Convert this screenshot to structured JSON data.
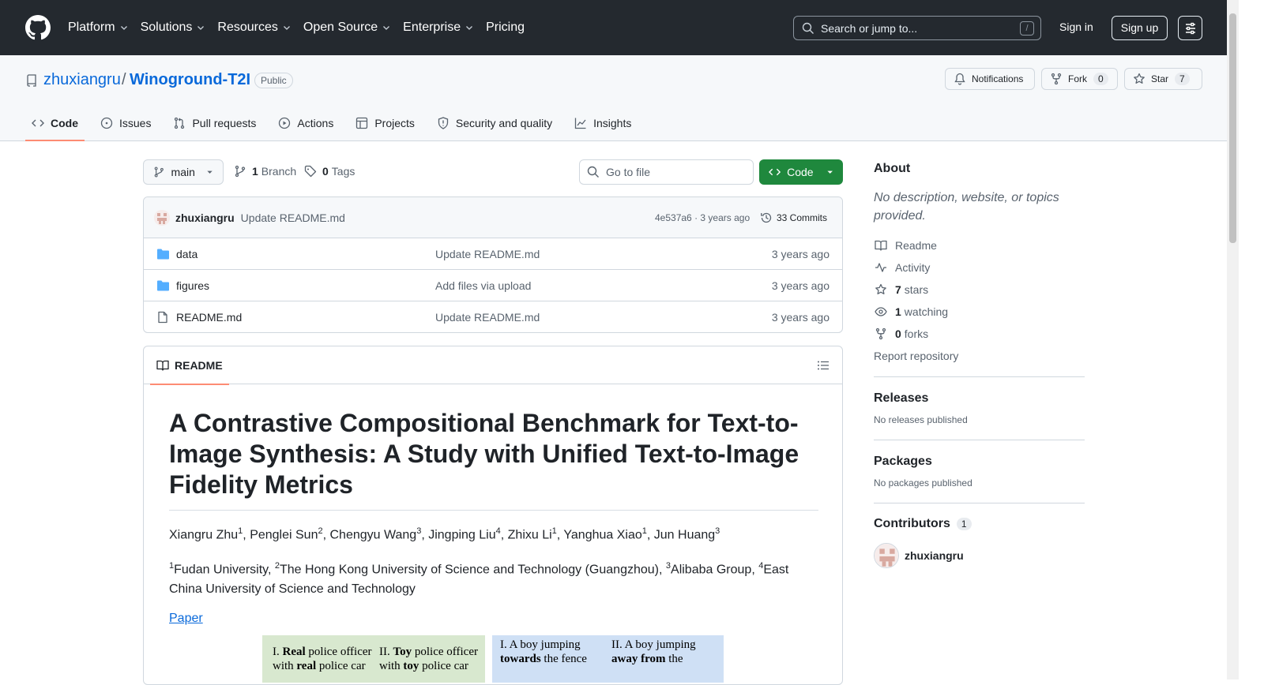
{
  "global_nav": {
    "items": [
      "Platform",
      "Solutions",
      "Resources",
      "Open Source",
      "Enterprise",
      "Pricing"
    ],
    "search_placeholder": "Search or jump to...",
    "search_shortcut": "/",
    "sign_in": "Sign in",
    "sign_up": "Sign up"
  },
  "repo": {
    "owner": "zhuxiangru",
    "separator": "/",
    "name": "Winoground-T2I",
    "visibility": "Public",
    "notifications_label": "Notifications",
    "fork_label": "Fork",
    "fork_count": "0",
    "star_label": "Star",
    "star_count": "7"
  },
  "tabs": [
    "Code",
    "Issues",
    "Pull requests",
    "Actions",
    "Projects",
    "Security and quality",
    "Insights"
  ],
  "toolbar": {
    "branch": "main",
    "branch_count": "1",
    "branch_label": "Branch",
    "tag_count": "0",
    "tag_label": "Tags",
    "goto_placeholder": "Go to file",
    "code_button": "Code"
  },
  "commit": {
    "author": "zhuxiangru",
    "message": "Update README.md",
    "hash": "4e537a6",
    "dot": "·",
    "time": "3 years ago",
    "commits_label": "33 Commits"
  },
  "files": [
    {
      "name": "data",
      "type": "folder",
      "message": "Update README.md",
      "time": "3 years ago"
    },
    {
      "name": "figures",
      "type": "folder",
      "message": "Add files via upload",
      "time": "3 years ago"
    },
    {
      "name": "README.md",
      "type": "file",
      "message": "Update README.md",
      "time": "3 years ago"
    }
  ],
  "readme": {
    "tab_label": "README",
    "title": "A Contrastive Compositional Benchmark for Text-to-Image Synthesis: A Study with Unified Text-to-Image Fidelity Metrics",
    "authors": [
      {
        "name": "Xiangru Zhu",
        "sup": "1"
      },
      {
        "name": "Penglei Sun",
        "sup": "2"
      },
      {
        "name": "Chengyu Wang",
        "sup": "3"
      },
      {
        "name": "Jingping Liu",
        "sup": "4"
      },
      {
        "name": "Zhixu Li",
        "sup": "1"
      },
      {
        "name": "Yanghua Xiao",
        "sup": "1"
      },
      {
        "name": "Jun Huang",
        "sup": "3"
      }
    ],
    "affiliations": [
      {
        "sup": "1",
        "name": "Fudan University"
      },
      {
        "sup": "2",
        "name": "The Hong Kong University of Science and Technology (Guangzhou)"
      },
      {
        "sup": "3",
        "name": "Alibaba Group"
      },
      {
        "sup": "4",
        "name": "East China University of Science and Technology"
      }
    ],
    "paper_link": "Paper",
    "figure_left": {
      "l1a": "I. ",
      "l1b": "Real",
      "l1c": " police officer",
      "l2a": "with ",
      "l2b": "real",
      "l2c": " police car",
      "r1a": "II. ",
      "r1b": "Toy",
      "r1c": " police officer",
      "r2a": "with ",
      "r2b": "toy",
      "r2c": " police car"
    },
    "figure_right": {
      "l1": "I. A boy jumping",
      "l2": "towards",
      "l2c": " the fence",
      "r1": "II. A boy jumping",
      "r2": "away from",
      "r2c": " the"
    }
  },
  "sidebar": {
    "about_title": "About",
    "about_desc": "No description, website, or topics provided.",
    "readme": "Readme",
    "activity": "Activity",
    "stars_count": "7",
    "stars_label": "stars",
    "watching_count": "1",
    "watching_label": "watching",
    "forks_count": "0",
    "forks_label": "forks",
    "report": "Report repository",
    "releases_title": "Releases",
    "releases_desc": "No releases published",
    "packages_title": "Packages",
    "packages_desc": "No packages published",
    "contributors_title": "Contributors",
    "contributors_count": "1",
    "contributor": "zhuxiangru"
  },
  "colors": {
    "header_bg": "#24292f",
    "link": "#0969da",
    "green_button": "#1f883d",
    "tab_underline": "#fd8c73"
  }
}
